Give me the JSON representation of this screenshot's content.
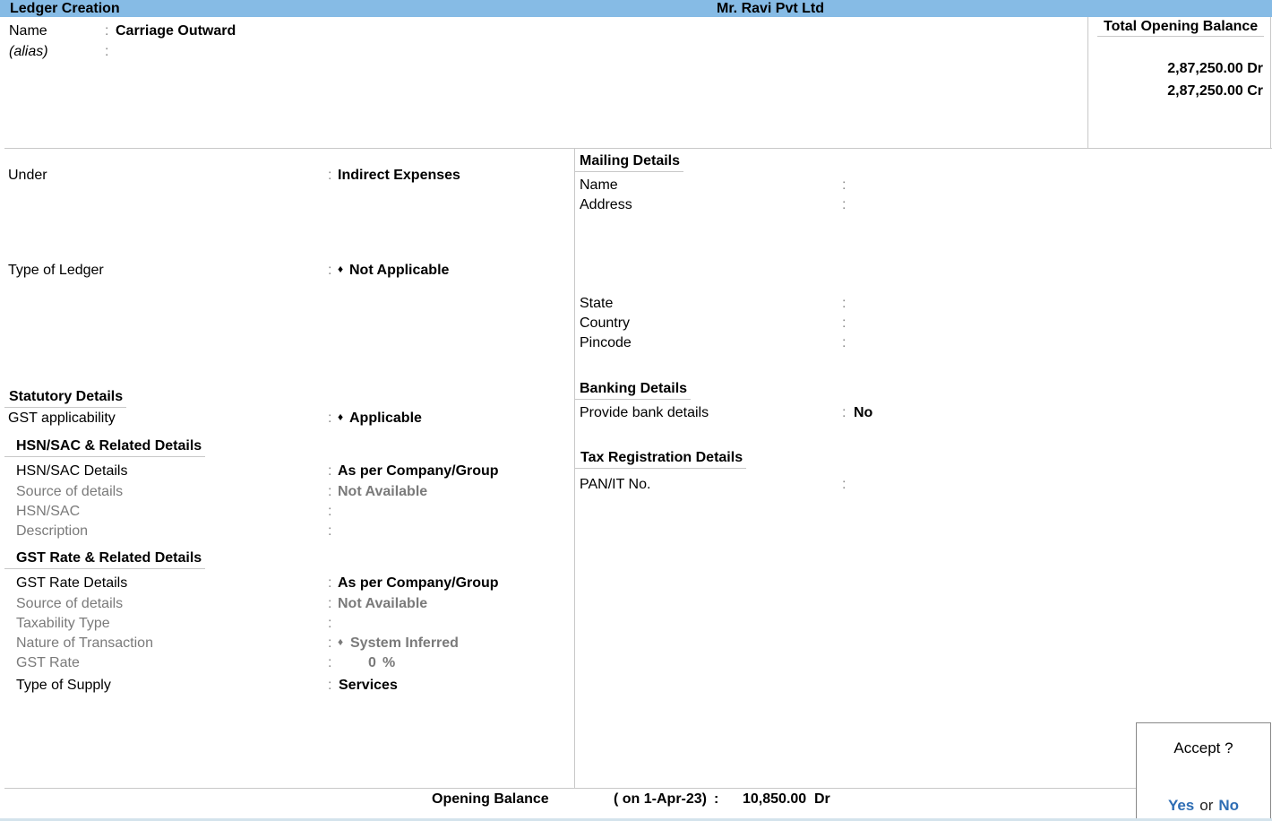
{
  "titlebar": {
    "title": "Ledger Creation",
    "company": "Mr. Ravi Pvt Ltd"
  },
  "header": {
    "name_label": "Name",
    "name_value": "Carriage Outward",
    "alias_label": "(alias)",
    "alias_value": "",
    "colon": ":"
  },
  "total_opening_balance": {
    "title": "Total Opening Balance",
    "debit": "2,87,250.00 Dr",
    "credit": "2,87,250.00 Cr"
  },
  "left": {
    "under_label": "Under",
    "under_value": "Indirect Expenses",
    "type_of_ledger_label": "Type of Ledger",
    "type_of_ledger_value": "Not Applicable",
    "statutory": {
      "heading": "Statutory Details",
      "gst_applicability_label": "GST applicability",
      "gst_applicability_value": "Applicable"
    },
    "hsn": {
      "heading": "HSN/SAC & Related Details",
      "rows": [
        {
          "label": "HSN/SAC Details",
          "value": "As per Company/Group"
        },
        {
          "label": "Source of details",
          "value": "Not Available"
        },
        {
          "label": "HSN/SAC",
          "value": ""
        },
        {
          "label": "Description",
          "value": ""
        }
      ]
    },
    "gst_rate": {
      "heading": "GST Rate & Related Details",
      "rows": [
        {
          "label": "GST Rate Details",
          "value": "As per Company/Group"
        },
        {
          "label": "Source of details",
          "value": "Not Available"
        },
        {
          "label": "Taxability Type",
          "value": ""
        },
        {
          "label": "Nature of Transaction",
          "value": "System Inferred"
        },
        {
          "label": "GST Rate",
          "value": "0",
          "unit": "%"
        },
        {
          "label": "Type of Supply",
          "value": "Services"
        }
      ]
    }
  },
  "right": {
    "mailing": {
      "heading": "Mailing Details",
      "name_label": "Name",
      "address_label": "Address",
      "state_label": "State",
      "country_label": "Country",
      "pincode_label": "Pincode"
    },
    "banking": {
      "heading": "Banking Details",
      "provide_label": "Provide bank details",
      "provide_value": "No"
    },
    "tax": {
      "heading": "Tax Registration Details",
      "pan_label": "PAN/IT No."
    }
  },
  "footer": {
    "opening_balance_label": "Opening Balance",
    "date_text": "( on 1-Apr-23)",
    "colon": ":",
    "amount": "10,850.00",
    "drcr": "Dr"
  },
  "accept_dialog": {
    "question": "Accept ?",
    "yes": "Yes",
    "or": "or",
    "no": "No"
  },
  "diamond": "♦"
}
